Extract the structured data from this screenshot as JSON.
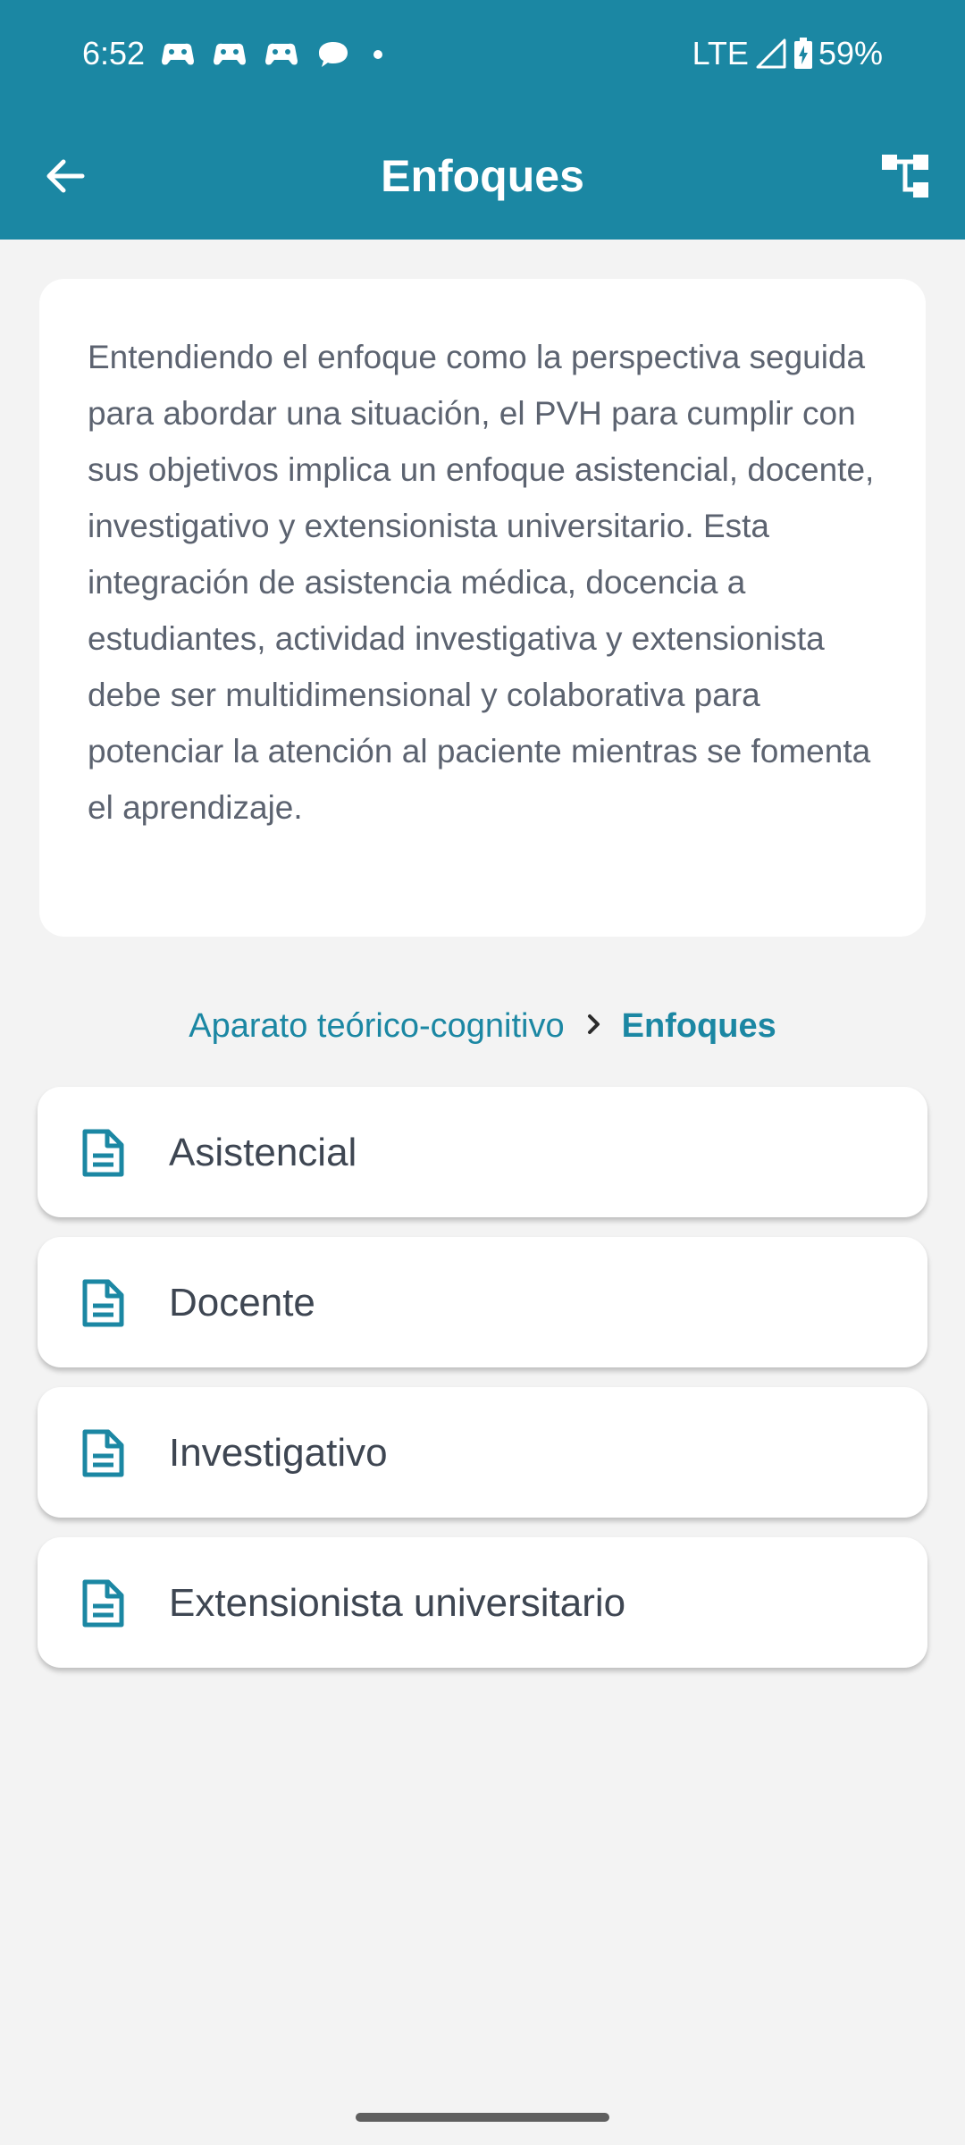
{
  "status_bar": {
    "time": "6:52",
    "network": "LTE",
    "battery": "59%",
    "notification_icons": [
      "game-controller-icon",
      "game-controller-icon",
      "game-controller-icon",
      "chat-bubble-icon",
      "more-dot-icon"
    ]
  },
  "app_bar": {
    "title": "Enfoques",
    "back_icon": "arrow-back-icon",
    "action_icon": "tree-structure-icon",
    "color": "#1b87a3"
  },
  "description": "Entendiendo el enfoque como la perspectiva seguida para abordar una situación, el PVH para cumplir con sus objetivos implica un enfoque asistencial, docente, investigativo y extensionista universitario. Esta integración de asistencia médica, docencia a estudiantes, actividad investigativa y extensionista debe ser multidimensional y colaborativa para potenciar la atención al paciente mientras se fomenta el aprendizaje.",
  "breadcrumb": {
    "parent": "Aparato teórico-cognitivo",
    "current": "Enfoques",
    "separator_icon": "chevron-right-icon"
  },
  "items": [
    {
      "label": "Asistencial",
      "icon": "document-icon"
    },
    {
      "label": "Docente",
      "icon": "document-icon"
    },
    {
      "label": "Investigativo",
      "icon": "document-icon"
    },
    {
      "label": "Extensionista universitario",
      "icon": "document-icon"
    }
  ],
  "colors": {
    "accent": "#1b87a3",
    "background": "#f3f3f3",
    "text": "#3e4652"
  }
}
